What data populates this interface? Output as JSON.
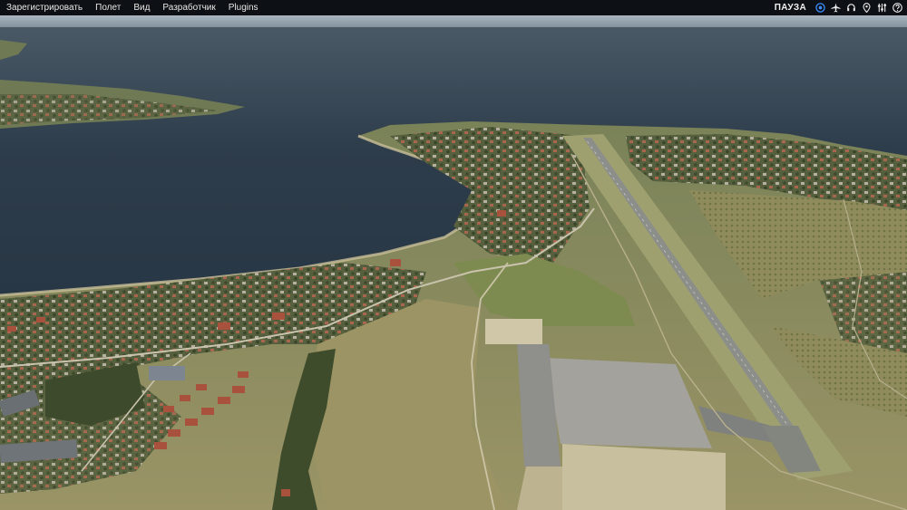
{
  "menubar": {
    "items": [
      {
        "label": "Зарегистрировать"
      },
      {
        "label": "Полет"
      },
      {
        "label": "Вид"
      },
      {
        "label": "Разработчик"
      },
      {
        "label": "Plugins"
      }
    ],
    "status": "ПАУЗА",
    "icons": [
      "record-icon",
      "airplane-icon",
      "headset-icon",
      "map-pin-icon",
      "sliders-icon",
      "help-icon"
    ]
  },
  "colors": {
    "menubar_bg": "#0d1014",
    "sea": "#253443",
    "land": "#8a9060",
    "runway": "#8c8e8a",
    "apron": "#9a9996"
  }
}
